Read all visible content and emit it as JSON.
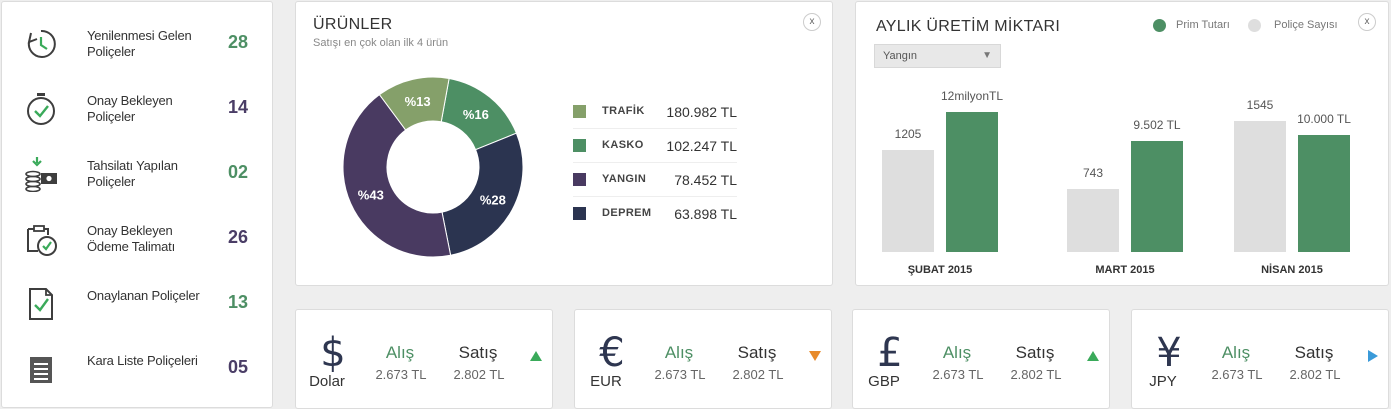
{
  "sidebar": {
    "items": [
      {
        "label": "Yenilenmesi Gelen Poliçeler",
        "count": "28",
        "icon": "clock-renew-icon"
      },
      {
        "label": "Onay Bekleyen Poliçeler",
        "count": "14",
        "icon": "stopwatch-check-icon"
      },
      {
        "label": "Tahsilatı Yapılan Poliçeler",
        "count": "02",
        "icon": "money-stack-icon"
      },
      {
        "label": "Onay Bekleyen Ödeme Talimatı",
        "count": "26",
        "icon": "document-timer-icon"
      },
      {
        "label": "Onaylanan Poliçeler",
        "count": "13",
        "icon": "document-check-icon"
      },
      {
        "label": "Kara Liste Poliçeleri",
        "count": "05",
        "icon": "list-document-icon"
      }
    ]
  },
  "products": {
    "title": "ÜRÜNLER",
    "subtitle": "Satışı en çok olan ilk 4 ürün",
    "close_label": "x"
  },
  "monthly": {
    "title": "AYLIK ÜRETİM MİKTARI",
    "dropdown_value": "Yangın",
    "legend": [
      "Prim Tutarı",
      "Poliçe Sayısı"
    ],
    "close_label": "x"
  },
  "chart_data": [
    {
      "type": "pie",
      "title": "ÜRÜNLER",
      "categories": [
        "TRAFİK",
        "KASKO",
        "YANGIN",
        "DEPREM"
      ],
      "values": [
        180982,
        102247,
        78452,
        63898
      ],
      "value_labels": [
        "180.982 TL",
        "102.247 TL",
        "78.452 TL",
        "63.898 TL"
      ],
      "slice_labels": [
        "%13",
        "%16",
        "%43",
        "%28"
      ],
      "slice_percents": [
        13,
        16,
        43,
        28
      ],
      "slice_colors": [
        "#85a06a",
        "#4d8f64",
        "#493a61",
        "#2b3450"
      ],
      "donut": true
    },
    {
      "type": "bar",
      "title": "AYLIK ÜRETİM MİKTARI",
      "categories": [
        "ŞUBAT 2015",
        "MART 2015",
        "NİSAN 2015"
      ],
      "series": [
        {
          "name": "Poliçe Sayısı",
          "values": [
            1205,
            743,
            1545
          ],
          "labels": [
            "1205",
            "743",
            "1545"
          ],
          "color": "#dedede"
        },
        {
          "name": "Prim Tutarı",
          "values": [
            12000,
            9502,
            10000
          ],
          "labels": [
            "12milyonTL",
            "9.502 TL",
            "10.000 TL"
          ],
          "color": "#4d8f64"
        }
      ],
      "legend_position": "top-right"
    }
  ],
  "currencies": [
    {
      "symbol": "$",
      "code": "Dolar",
      "buy_label": "Alış",
      "sell_label": "Satış",
      "buy": "2.673 TL",
      "sell": "2.802 TL",
      "trend": "up"
    },
    {
      "symbol": "€",
      "code": "EUR",
      "buy_label": "Alış",
      "sell_label": "Satış",
      "buy": "2.673 TL",
      "sell": "2.802 TL",
      "trend": "down"
    },
    {
      "symbol": "£",
      "code": "GBP",
      "buy_label": "Alış",
      "sell_label": "Satış",
      "buy": "2.673 TL",
      "sell": "2.802 TL",
      "trend": "up"
    },
    {
      "symbol": "¥",
      "code": "JPY",
      "buy_label": "Alış",
      "sell_label": "Satış",
      "buy": "2.673 TL",
      "sell": "2.802 TL",
      "trend": "right"
    }
  ]
}
